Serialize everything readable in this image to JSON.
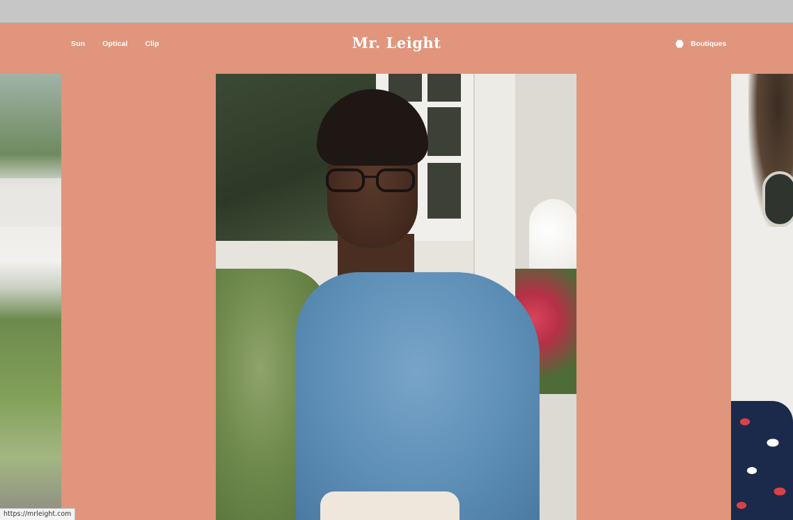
{
  "header": {
    "nav_left": [
      {
        "label": "Sun"
      },
      {
        "label": "Optical"
      },
      {
        "label": "Clip"
      }
    ],
    "logo": "Mr. Leight",
    "boutiques_label": "Boutiques",
    "boutiques_icon": "hexagon-icon"
  },
  "colors": {
    "background": "#e0957c",
    "header_text": "#ffffff"
  },
  "carousel": {
    "slides": [
      {
        "id": "left-partial"
      },
      {
        "id": "center"
      },
      {
        "id": "right-partial"
      }
    ]
  },
  "status_bar": {
    "url": "https://mrleight.com"
  }
}
